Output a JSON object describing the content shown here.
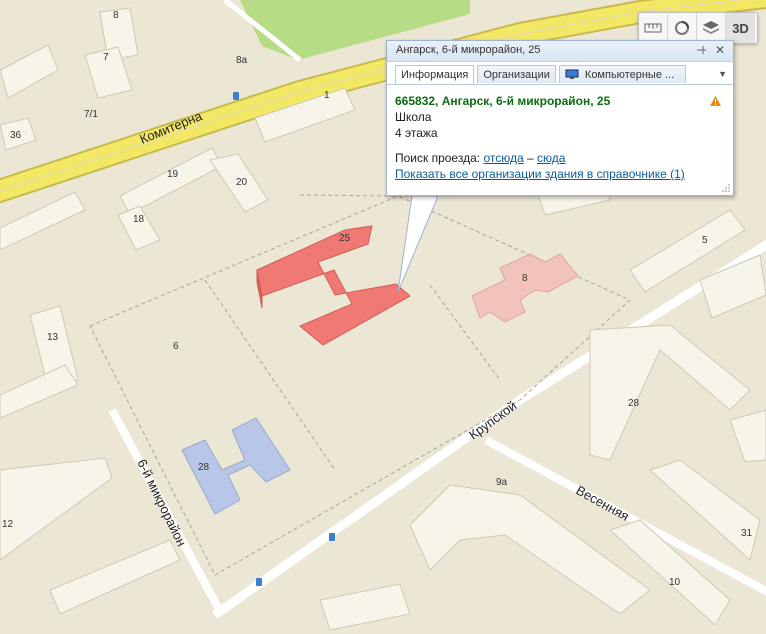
{
  "colors": {
    "background": "#ece6d4",
    "park": "#b6dc86",
    "road_main": "#f3e766",
    "road_edge": "#c8ba4a",
    "building_selected": "#f07a73",
    "building_school2": "#b8c6e8",
    "building_kindergarten": "#f2c3bb",
    "address_green": "#0e6b12",
    "link_blue": "#0a5c99"
  },
  "toolbar": {
    "ruler_icon": "ruler-icon",
    "traffic_icon": "traffic-icon",
    "layers_icon": "layers-icon",
    "label_3d": "3D"
  },
  "popup": {
    "title": "Ангарск, 6-й микрорайон, 25",
    "tabs": [
      "Информация",
      "Организации",
      "Компьютерные ..."
    ],
    "address": "665832, Ангарск, 6-й микрорайон, 25",
    "building_type": "Школа",
    "floors": "4 этажа",
    "route_prefix": "Поиск проезда:",
    "route_from": "отсюда",
    "route_sep": "–",
    "route_to": "сюда",
    "show_all": "Показать все организации здания в справочнике (1)"
  },
  "map": {
    "streets": [
      "Комитерна",
      "Крупской",
      "Весенняя",
      "6-й микрорайон"
    ],
    "district": "6",
    "building_numbers": [
      "8",
      "7",
      "8а",
      "7/1",
      "36",
      "1",
      "19",
      "20",
      "18",
      "25",
      "8",
      "5",
      "13",
      "28",
      "28",
      "9а",
      "31",
      "10",
      "12"
    ]
  }
}
